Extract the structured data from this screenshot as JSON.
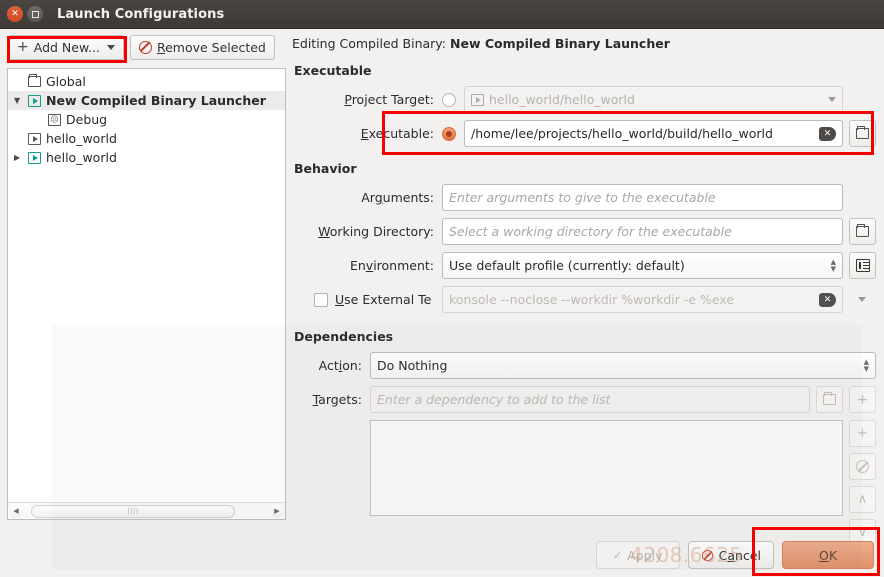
{
  "window": {
    "title": "Launch Configurations",
    "close_icon": "close-icon",
    "maximize_icon": "maximize-icon"
  },
  "toolbar": {
    "add_new_label": "Add New...",
    "add_new_plus": "+",
    "remove_selected_label": "Remove Selected"
  },
  "tree": {
    "items": [
      {
        "label": "Global",
        "icon": "folder-icon",
        "arrow": "none",
        "selected": false,
        "indent": 0
      },
      {
        "label": "New Compiled Binary Launcher",
        "icon": "launcher-icon",
        "arrow": "down",
        "selected": true,
        "indent": 0
      },
      {
        "label": "Debug",
        "icon": "debug-icon",
        "arrow": "none",
        "selected": false,
        "indent": 2
      },
      {
        "label": "hello_world",
        "icon": "launcher-gray-icon",
        "arrow": "none",
        "selected": false,
        "indent": 0
      },
      {
        "label": "hello_world",
        "icon": "launcher-icon",
        "arrow": "right",
        "selected": false,
        "indent": 0
      }
    ],
    "scrollbar_left_arrow": "◀",
    "scrollbar_right_arrow": "▶",
    "scrollbar_grip": "||||"
  },
  "editing": {
    "prefix": "Editing Compiled Binary:",
    "name": "New Compiled Binary Launcher"
  },
  "executable_group": {
    "heading": "Executable",
    "project_target_label": "Project Target:",
    "project_target_value": "hello_world/hello_world",
    "project_target_selected": false,
    "executable_label": "Executable:",
    "executable_value": "/home/lee/projects/hello_world/build/hello_world",
    "executable_selected": true,
    "clear_icon": "clear-icon",
    "browse_icon": "folder-browse-icon"
  },
  "behavior_group": {
    "heading": "Behavior",
    "arguments_label": "Arguments:",
    "arguments_placeholder": "Enter arguments to give to the executable",
    "arguments_value": "",
    "working_directory_label": "Working Directory:",
    "working_directory_placeholder": "Select a working directory for the executable",
    "working_directory_value": "",
    "environment_label": "Environment:",
    "environment_value": "Use default profile (currently: default)",
    "environment_config_icon": "environment-config-icon",
    "use_external_terminal_label": "Use External Te",
    "use_external_terminal_checked": false,
    "terminal_command_value": "konsole --noclose --workdir %workdir -e %exe"
  },
  "dependencies_group": {
    "heading": "Dependencies",
    "action_label": "Action:",
    "action_value": "Do Nothing",
    "targets_label": "Targets:",
    "targets_placeholder": "Enter a dependency to add to the list",
    "targets_value": "",
    "targets_list": [],
    "browse_icon": "folder-browse-icon",
    "add_icon": "plus-icon",
    "remove_icon": "remove-icon",
    "move_up_icon": "chevron-up-icon",
    "move_down_icon": "chevron-down-icon",
    "add_label": "+",
    "move_up_label": "∧",
    "move_down_label": "∨"
  },
  "footer": {
    "apply_label": "Apply",
    "apply_enabled": false,
    "cancel_label": "Cancel",
    "ok_label": "OK",
    "apply_check_icon": "check-icon",
    "cancel_ban_icon": "ban-icon"
  },
  "watermark": {
    "text": "4208.6625"
  },
  "colors": {
    "accent_orange": "#e2906a",
    "annotation_red": "#f40000",
    "titlebar": "#433f3c",
    "launcher_teal": "#0f9b8e"
  }
}
